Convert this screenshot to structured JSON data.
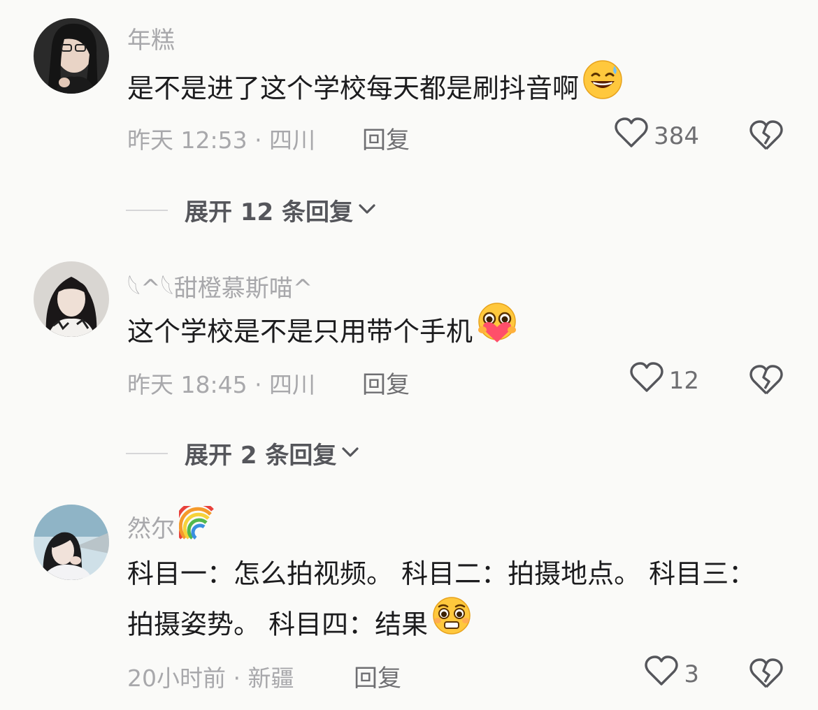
{
  "comments": [
    {
      "username": "年糕",
      "text": "是不是进了这个学校每天都是刷抖音啊",
      "text_emoji": "grinning-sweat-emoji",
      "time_location": "昨天 12:53 · 四川",
      "reply_label": "回复",
      "likes": "384",
      "expand_label": "展开 12 条回复"
    },
    {
      "username": "𓆩^𓆩甜橙慕斯喵^",
      "text": "这个学校是不是只用带个手机",
      "text_emoji": "pleading-heart-emoji",
      "time_location": "昨天 18:45 · 四川",
      "reply_label": "回复",
      "likes": "12",
      "expand_label": "展开 2 条回复"
    },
    {
      "username": "然尔",
      "username_emoji": "rainbow-emoji",
      "text": "科目一：怎么拍视频。 科目二：拍摄地点。 科目三：拍摄姿势。 科目四：结果",
      "text_emoji": "pleading-face-emoji",
      "time_location": "20小时前 · 新疆",
      "reply_label": "回复",
      "likes": "3"
    }
  ],
  "icons": {
    "like": "heart-outline-icon",
    "dislike": "broken-heart-icon",
    "expand": "chevron-down-icon"
  },
  "colors": {
    "background": "#fafaf8",
    "text": "#1c1c1e",
    "secondary": "#a8a8ab",
    "action": "#6f6f72"
  }
}
